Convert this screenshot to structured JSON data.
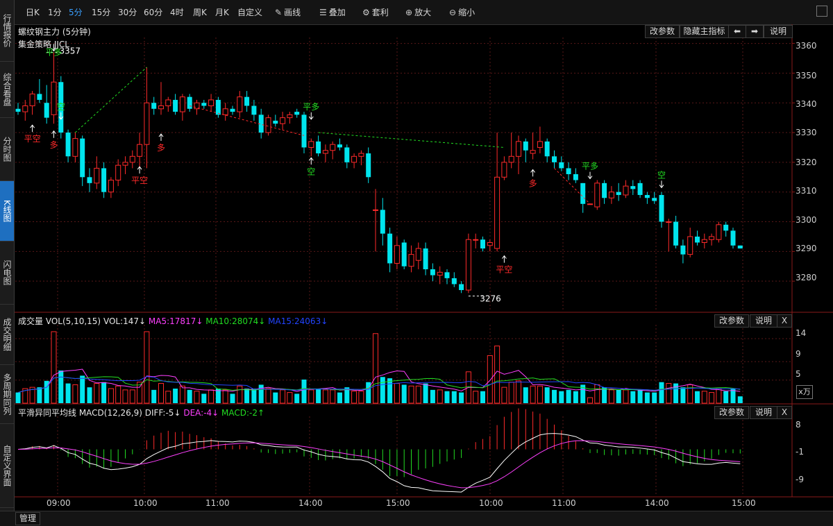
{
  "left_nav": {
    "items": [
      {
        "label": "行情报价",
        "active": false
      },
      {
        "label": "综合看盘",
        "active": false
      },
      {
        "label": "分时图",
        "active": false
      },
      {
        "label": "K线图",
        "active": true
      },
      {
        "label": "闪电图",
        "active": false
      },
      {
        "label": "成交明细",
        "active": false
      },
      {
        "label": "多周期同列",
        "active": false
      },
      {
        "label": "自定义界面",
        "active": false
      }
    ]
  },
  "toolbar": {
    "period_buttons": [
      "日K",
      "1分",
      "5分",
      "15分",
      "30分",
      "60分",
      "4时",
      "周K",
      "月K",
      "自定义"
    ],
    "active_period": "5分",
    "draw_label": "画线",
    "overlay_label": "叠加",
    "arbitrage_label": "套利",
    "zoom_in_label": "放大",
    "zoom_out_label": "缩小"
  },
  "main_panel": {
    "title": "螺纹钢主力 (5分钟)",
    "indicator": "集金策略 JJCL",
    "buttons": {
      "change_params": "改参数",
      "hide_indicator": "隐藏主指标",
      "prev": "⬅",
      "next": "➡",
      "help": "说明"
    }
  },
  "volume_panel": {
    "title_prefix": "成交量 VOL(5,10,15)",
    "vol": "VOL:147↓",
    "ma5": "MA5:17817↓",
    "ma10": "MA10:28074↓",
    "ma15": "MA15:24063↓",
    "buttons": {
      "change_params": "改参数",
      "help": "说明",
      "close": "X"
    },
    "fx_label": "x万"
  },
  "macd_panel": {
    "title_prefix": "平滑异同平均线 MACD(12,26,9)",
    "diff": "DIFF:-5↓",
    "dea": "DEA:-4↓",
    "macd": "MACD:-2↑",
    "buttons": {
      "change_params": "改参数",
      "help": "说明",
      "close": "X"
    }
  },
  "bottom_bar": {
    "manage_label": "管理"
  },
  "colors": {
    "up": "#ff2a2a",
    "down": "#00e5ee",
    "ma5": "#ff40ff",
    "ma10": "#22dd22",
    "ma15": "#2244ff",
    "dif": "#ffffff",
    "dea": "#ff40ff",
    "grid": "#5a1818"
  },
  "chart_data": [
    {
      "type": "candlestick",
      "title": "螺纹钢主力 (5分钟)",
      "y_ticks": [
        3360,
        3350,
        3340,
        3330,
        3320,
        3310,
        3300,
        3290,
        3280
      ],
      "ylim": [
        3270,
        3362
      ],
      "x_ticks": [
        "09:00",
        "10:00",
        "11:00",
        "14:00",
        "15:00",
        "10:00",
        "11:00",
        "14:00",
        "15:00"
      ],
      "annotations": [
        {
          "text": "平多",
          "color": "green"
        },
        {
          "text": "3357",
          "color": "white"
        },
        {
          "text": "平空",
          "color": "red"
        },
        {
          "text": "多",
          "color": "red"
        },
        {
          "text": "空",
          "color": "green"
        },
        {
          "text": "平空",
          "color": "red"
        },
        {
          "text": "多",
          "color": "red"
        },
        {
          "text": "平多",
          "color": "green"
        },
        {
          "text": "空",
          "color": "green"
        },
        {
          "text": "3276",
          "color": "white"
        },
        {
          "text": "平空",
          "color": "red"
        },
        {
          "text": "多",
          "color": "red"
        },
        {
          "text": "平多",
          "color": "green"
        },
        {
          "text": "空",
          "color": "green"
        }
      ],
      "candles": [
        {
          "o": 3338,
          "h": 3340,
          "l": 3336,
          "c": 3337
        },
        {
          "o": 3337,
          "h": 3341,
          "l": 3334,
          "c": 3339
        },
        {
          "o": 3339,
          "h": 3344,
          "l": 3336,
          "c": 3343
        },
        {
          "o": 3343,
          "h": 3348,
          "l": 3340,
          "c": 3341
        },
        {
          "o": 3340,
          "h": 3346,
          "l": 3333,
          "c": 3335
        },
        {
          "o": 3336,
          "h": 3357,
          "l": 3333,
          "c": 3347
        },
        {
          "o": 3347,
          "h": 3349,
          "l": 3328,
          "c": 3330
        },
        {
          "o": 3330,
          "h": 3331,
          "l": 3320,
          "c": 3322
        },
        {
          "o": 3322,
          "h": 3330,
          "l": 3320,
          "c": 3328
        },
        {
          "o": 3328,
          "h": 3329,
          "l": 3312,
          "c": 3315
        },
        {
          "o": 3315,
          "h": 3318,
          "l": 3310,
          "c": 3313
        },
        {
          "o": 3313,
          "h": 3322,
          "l": 3311,
          "c": 3318
        },
        {
          "o": 3318,
          "h": 3320,
          "l": 3308,
          "c": 3310
        },
        {
          "o": 3310,
          "h": 3315,
          "l": 3308,
          "c": 3314
        },
        {
          "o": 3314,
          "h": 3321,
          "l": 3312,
          "c": 3319
        },
        {
          "o": 3319,
          "h": 3322,
          "l": 3316,
          "c": 3320
        },
        {
          "o": 3320,
          "h": 3324,
          "l": 3318,
          "c": 3322
        },
        {
          "o": 3322,
          "h": 3330,
          "l": 3318,
          "c": 3326
        },
        {
          "o": 3326,
          "h": 3352,
          "l": 3318,
          "c": 3340
        },
        {
          "o": 3340,
          "h": 3342,
          "l": 3336,
          "c": 3338
        },
        {
          "o": 3338,
          "h": 3347,
          "l": 3336,
          "c": 3339
        },
        {
          "o": 3339,
          "h": 3342,
          "l": 3337,
          "c": 3341
        },
        {
          "o": 3341,
          "h": 3343,
          "l": 3336,
          "c": 3337
        },
        {
          "o": 3337,
          "h": 3343,
          "l": 3334,
          "c": 3342
        },
        {
          "o": 3342,
          "h": 3343,
          "l": 3337,
          "c": 3338
        },
        {
          "o": 3338,
          "h": 3341,
          "l": 3336,
          "c": 3340
        },
        {
          "o": 3340,
          "h": 3341,
          "l": 3338,
          "c": 3339
        },
        {
          "o": 3339,
          "h": 3343,
          "l": 3337,
          "c": 3341
        },
        {
          "o": 3341,
          "h": 3342,
          "l": 3335,
          "c": 3336
        },
        {
          "o": 3336,
          "h": 3340,
          "l": 3334,
          "c": 3338
        },
        {
          "o": 3338,
          "h": 3339,
          "l": 3336,
          "c": 3337
        },
        {
          "o": 3337,
          "h": 3344,
          "l": 3335,
          "c": 3342
        },
        {
          "o": 3342,
          "h": 3344,
          "l": 3337,
          "c": 3339
        },
        {
          "o": 3339,
          "h": 3341,
          "l": 3334,
          "c": 3336
        },
        {
          "o": 3336,
          "h": 3338,
          "l": 3328,
          "c": 3330
        },
        {
          "o": 3330,
          "h": 3336,
          "l": 3329,
          "c": 3335
        },
        {
          "o": 3334,
          "h": 3336,
          "l": 3332,
          "c": 3333
        },
        {
          "o": 3333,
          "h": 3337,
          "l": 3331,
          "c": 3335
        },
        {
          "o": 3335,
          "h": 3337,
          "l": 3333,
          "c": 3336
        },
        {
          "o": 3337,
          "h": 3338,
          "l": 3335,
          "c": 3336
        },
        {
          "o": 3336,
          "h": 3337,
          "l": 3323,
          "c": 3325
        },
        {
          "o": 3325,
          "h": 3328,
          "l": 3322,
          "c": 3327
        },
        {
          "o": 3327,
          "h": 3329,
          "l": 3322,
          "c": 3323
        },
        {
          "o": 3323,
          "h": 3326,
          "l": 3320,
          "c": 3324
        },
        {
          "o": 3324,
          "h": 3327,
          "l": 3321,
          "c": 3326
        },
        {
          "o": 3326,
          "h": 3328,
          "l": 3324,
          "c": 3325
        },
        {
          "o": 3325,
          "h": 3326,
          "l": 3318,
          "c": 3320
        },
        {
          "o": 3320,
          "h": 3323,
          "l": 3318,
          "c": 3322
        },
        {
          "o": 3322,
          "h": 3324,
          "l": 3319,
          "c": 3323
        },
        {
          "o": 3323,
          "h": 3325,
          "l": 3313,
          "c": 3315
        },
        {
          "o": 3304,
          "h": 3311,
          "l": 3290,
          "c": 3304
        },
        {
          "o": 3304,
          "h": 3308,
          "l": 3292,
          "c": 3296
        },
        {
          "o": 3296,
          "h": 3298,
          "l": 3283,
          "c": 3286
        },
        {
          "o": 3286,
          "h": 3295,
          "l": 3284,
          "c": 3292
        },
        {
          "o": 3293,
          "h": 3294,
          "l": 3284,
          "c": 3285
        },
        {
          "o": 3285,
          "h": 3292,
          "l": 3283,
          "c": 3289
        },
        {
          "o": 3287,
          "h": 3293,
          "l": 3284,
          "c": 3291
        },
        {
          "o": 3291,
          "h": 3293,
          "l": 3282,
          "c": 3284
        },
        {
          "o": 3284,
          "h": 3286,
          "l": 3280,
          "c": 3282
        },
        {
          "o": 3282,
          "h": 3285,
          "l": 3279,
          "c": 3283
        },
        {
          "o": 3283,
          "h": 3284,
          "l": 3279,
          "c": 3281
        },
        {
          "o": 3281,
          "h": 3283,
          "l": 3278,
          "c": 3279
        },
        {
          "o": 3279,
          "h": 3280,
          "l": 3276,
          "c": 3277
        },
        {
          "o": 3277,
          "h": 3296,
          "l": 3276,
          "c": 3294
        },
        {
          "o": 3294,
          "h": 3296,
          "l": 3291,
          "c": 3294
        },
        {
          "o": 3294,
          "h": 3295,
          "l": 3290,
          "c": 3291
        },
        {
          "o": 3292,
          "h": 3294,
          "l": 3290,
          "c": 3293
        },
        {
          "o": 3291,
          "h": 3330,
          "l": 3290,
          "c": 3315
        },
        {
          "o": 3315,
          "h": 3322,
          "l": 3314,
          "c": 3320
        },
        {
          "o": 3320,
          "h": 3330,
          "l": 3318,
          "c": 3322
        },
        {
          "o": 3322,
          "h": 3329,
          "l": 3316,
          "c": 3327
        },
        {
          "o": 3327,
          "h": 3328,
          "l": 3320,
          "c": 3324
        },
        {
          "o": 3323,
          "h": 3330,
          "l": 3321,
          "c": 3324
        },
        {
          "o": 3325,
          "h": 3332,
          "l": 3323,
          "c": 3327
        },
        {
          "o": 3327,
          "h": 3328,
          "l": 3320,
          "c": 3322
        },
        {
          "o": 3322,
          "h": 3324,
          "l": 3318,
          "c": 3320
        },
        {
          "o": 3320,
          "h": 3322,
          "l": 3317,
          "c": 3318
        },
        {
          "o": 3318,
          "h": 3320,
          "l": 3314,
          "c": 3316
        },
        {
          "o": 3316,
          "h": 3318,
          "l": 3313,
          "c": 3314
        },
        {
          "o": 3313,
          "h": 3313,
          "l": 3303,
          "c": 3306
        },
        {
          "o": 3306,
          "h": 3306,
          "l": 3306,
          "c": 3306
        },
        {
          "o": 3305,
          "h": 3314,
          "l": 3304,
          "c": 3313
        },
        {
          "o": 3313,
          "h": 3314,
          "l": 3306,
          "c": 3308
        },
        {
          "o": 3308,
          "h": 3312,
          "l": 3306,
          "c": 3310
        },
        {
          "o": 3310,
          "h": 3313,
          "l": 3307,
          "c": 3309
        },
        {
          "o": 3309,
          "h": 3314,
          "l": 3308,
          "c": 3312
        },
        {
          "o": 3312,
          "h": 3314,
          "l": 3309,
          "c": 3311
        },
        {
          "o": 3313,
          "h": 3314,
          "l": 3308,
          "c": 3309
        },
        {
          "o": 3309,
          "h": 3310,
          "l": 3306,
          "c": 3308
        },
        {
          "o": 3308,
          "h": 3310,
          "l": 3306,
          "c": 3307
        },
        {
          "o": 3309,
          "h": 3310,
          "l": 3298,
          "c": 3300
        },
        {
          "o": 3300,
          "h": 3301,
          "l": 3290,
          "c": 3300
        },
        {
          "o": 3300,
          "h": 3302,
          "l": 3291,
          "c": 3292
        },
        {
          "o": 3292,
          "h": 3294,
          "l": 3286,
          "c": 3289
        },
        {
          "o": 3289,
          "h": 3298,
          "l": 3288,
          "c": 3295
        },
        {
          "o": 3295,
          "h": 3297,
          "l": 3292,
          "c": 3293
        },
        {
          "o": 3293,
          "h": 3296,
          "l": 3291,
          "c": 3294
        },
        {
          "o": 3294,
          "h": 3296,
          "l": 3292,
          "c": 3295
        },
        {
          "o": 3294,
          "h": 3300,
          "l": 3293,
          "c": 3299
        },
        {
          "o": 3299,
          "h": 3300,
          "l": 3295,
          "c": 3297
        },
        {
          "o": 3297,
          "h": 3298,
          "l": 3291,
          "c": 3292
        },
        {
          "o": 3292,
          "h": 3292,
          "l": 3291,
          "c": 3291
        }
      ]
    },
    {
      "type": "bar",
      "title": "成交量 VOL(5,10,15)",
      "y_ticks": [
        14,
        9,
        5
      ],
      "unit": "x万",
      "ylim": [
        0,
        17
      ]
    },
    {
      "type": "bar",
      "title": "平滑异同平均线 MACD(12,26,9)",
      "y_ticks": [
        8,
        -1,
        -9
      ],
      "ylim": [
        -14,
        10
      ]
    }
  ]
}
